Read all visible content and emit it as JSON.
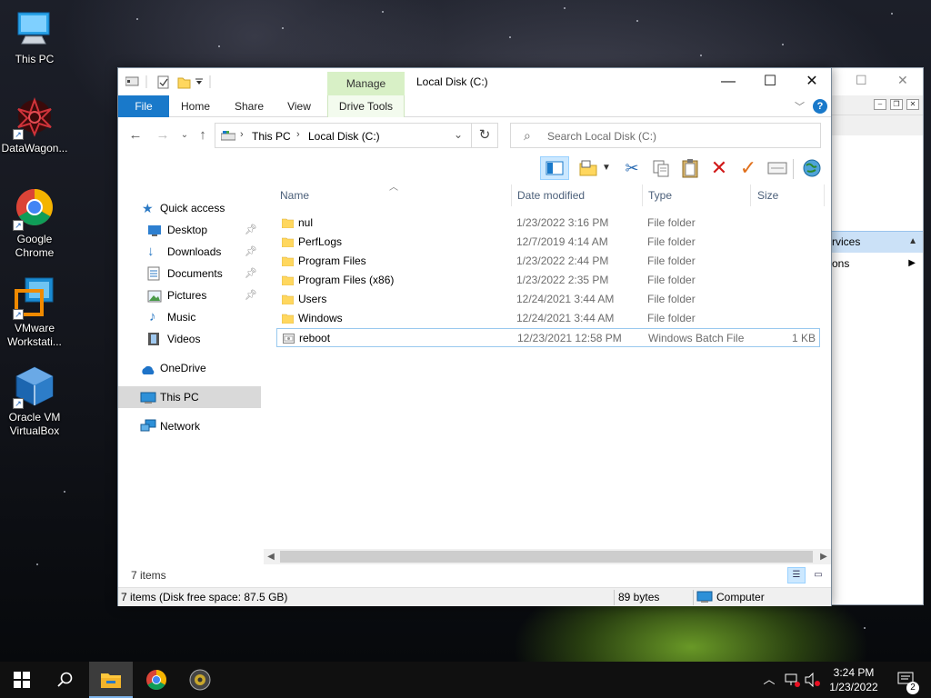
{
  "desktop": {
    "icons": [
      {
        "label": "This PC"
      },
      {
        "label": "DataWagon..."
      },
      {
        "label": "Google Chrome"
      },
      {
        "label": "VMware Workstati..."
      },
      {
        "label": "Oracle VM VirtualBox"
      }
    ]
  },
  "background_window": {
    "row_selected": "rvices",
    "row2": "ons"
  },
  "explorer": {
    "title": "Local Disk (C:)",
    "context_tab_group": "Manage",
    "tabs": {
      "file": "File",
      "home": "Home",
      "share": "Share",
      "view": "View",
      "drive_tools": "Drive Tools"
    },
    "help": "?",
    "address": {
      "crumbs": [
        "This PC",
        "Local Disk (C:)"
      ]
    },
    "search": {
      "placeholder": "Search Local Disk (C:)"
    },
    "nav": [
      {
        "label": "Quick access"
      },
      {
        "label": "Desktop",
        "pinned": true
      },
      {
        "label": "Downloads",
        "pinned": true
      },
      {
        "label": "Documents",
        "pinned": true
      },
      {
        "label": "Pictures",
        "pinned": true
      },
      {
        "label": "Music"
      },
      {
        "label": "Videos"
      },
      {
        "label": "OneDrive"
      },
      {
        "label": "This PC",
        "selected": true
      },
      {
        "label": "Network"
      }
    ],
    "columns": {
      "name": "Name",
      "date": "Date modified",
      "type": "Type",
      "size": "Size"
    },
    "files": [
      {
        "name": "nul",
        "date": "1/23/2022 3:16 PM",
        "type": "File folder",
        "size": ""
      },
      {
        "name": "PerfLogs",
        "date": "12/7/2019 4:14 AM",
        "type": "File folder",
        "size": ""
      },
      {
        "name": "Program Files",
        "date": "1/23/2022 2:44 PM",
        "type": "File folder",
        "size": ""
      },
      {
        "name": "Program Files (x86)",
        "date": "1/23/2022 2:35 PM",
        "type": "File folder",
        "size": ""
      },
      {
        "name": "Users",
        "date": "12/24/2021 3:44 AM",
        "type": "File folder",
        "size": ""
      },
      {
        "name": "Windows",
        "date": "12/24/2021 3:44 AM",
        "type": "File folder",
        "size": ""
      },
      {
        "name": "reboot",
        "date": "12/23/2021 12:58 PM",
        "type": "Windows Batch File",
        "size": "1 KB"
      }
    ],
    "item_count": "7 items",
    "status": {
      "summary": "7 items (Disk free space: 87.5 GB)",
      "bytes": "89 bytes",
      "location": "Computer"
    }
  },
  "taskbar": {
    "clock_time": "3:24 PM",
    "clock_date": "1/23/2022",
    "notification_count": "2"
  },
  "colors": {
    "accent": "#1979ca",
    "manage_tab": "#d8f0c6",
    "selection": "#d9d9d9",
    "taskbar": "#101010"
  }
}
